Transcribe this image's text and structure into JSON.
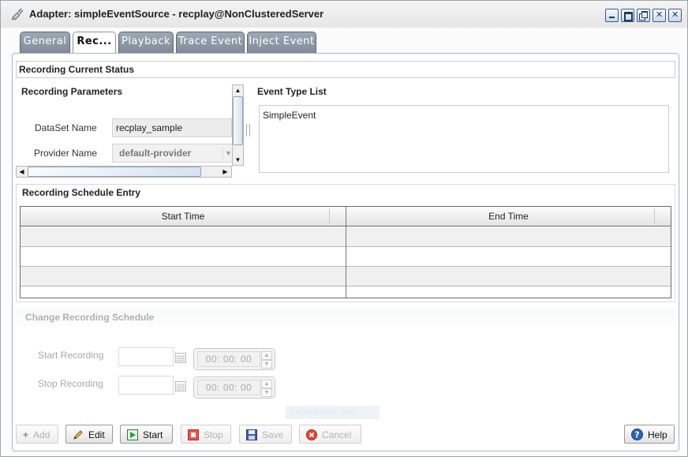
{
  "window": {
    "title": "Adapter: simpleEventSource - recplay@NonClusteredServer"
  },
  "tabs": [
    {
      "label": "General",
      "active": false
    },
    {
      "label": "Rec...",
      "active": true
    },
    {
      "label": "Playback",
      "active": false
    },
    {
      "label": "Trace Event",
      "active": false
    },
    {
      "label": "Inject Event",
      "active": false
    }
  ],
  "recording": {
    "status_header": "Recording Current Status",
    "parameters_header": "Recording Parameters",
    "dataset_label": "DataSet Name",
    "dataset_value": "recplay_sample",
    "provider_label": "Provider Name",
    "provider_value": "default-provider",
    "event_type_header": "Event Type List",
    "event_types": [
      "SimpleEvent"
    ]
  },
  "schedule": {
    "header": "Recording Schedule Entry",
    "columns": [
      "Start Time",
      "End Time"
    ],
    "rows": [
      [
        "",
        ""
      ],
      [
        "",
        ""
      ],
      [
        "",
        ""
      ],
      [
        "",
        ""
      ]
    ]
  },
  "change_schedule": {
    "header": "Change Recording Schedule",
    "start_label": "Start Recording",
    "stop_label": "Stop Recording",
    "start_time": "00: 00: 00",
    "stop_time": "00: 00: 00",
    "ghost_text": "Recording/in Sep"
  },
  "buttons": {
    "add": "Add",
    "edit": "Edit",
    "start": "Start",
    "stop": "Stop",
    "save": "Save",
    "cancel": "Cancel",
    "help": "Help"
  },
  "colors": {
    "tab_inactive": "#8e9aa6",
    "accent": "#1d3a66",
    "start_green": "#2e9a3a",
    "stop_red": "#e23a3a",
    "cancel_red": "#d93a2f",
    "help_blue": "#2b63b8"
  }
}
